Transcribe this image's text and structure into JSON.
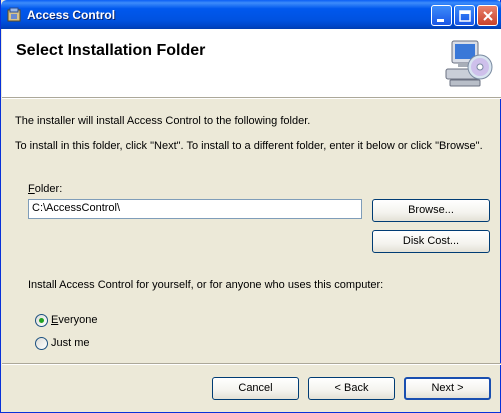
{
  "window": {
    "title": "Access Control",
    "app_icon": "installer-icon",
    "controls": [
      "minimize-icon",
      "maximize-icon",
      "close-icon"
    ]
  },
  "banner": {
    "title": "Select Installation Folder",
    "icon": "computer-cd-icon"
  },
  "body": {
    "intro_line1": "The installer will install Access Control to the following folder.",
    "intro_line2": "To install in this folder, click \"Next\". To install to a different folder, enter it below or click \"Browse\".",
    "folder_label_accel": "F",
    "folder_label_rest": "older:",
    "folder_value": "C:\\AccessControl\\",
    "browse_label": "Browse...",
    "disk_cost_label": "Disk Cost...",
    "install_for_label": "Install Access Control for yourself, or for anyone who uses this computer:",
    "options": [
      {
        "accel": "E",
        "rest": "veryone",
        "selected": true
      },
      {
        "accel": "",
        "rest": "Just me",
        "selected": false
      }
    ]
  },
  "footer": {
    "cancel_label": "Cancel",
    "back_label": "< Back",
    "next_label": "Next >"
  },
  "colors": {
    "title_bar": "#0058ee",
    "dialog_bg": "#ece9d8",
    "radio_dot": "#21a121"
  }
}
